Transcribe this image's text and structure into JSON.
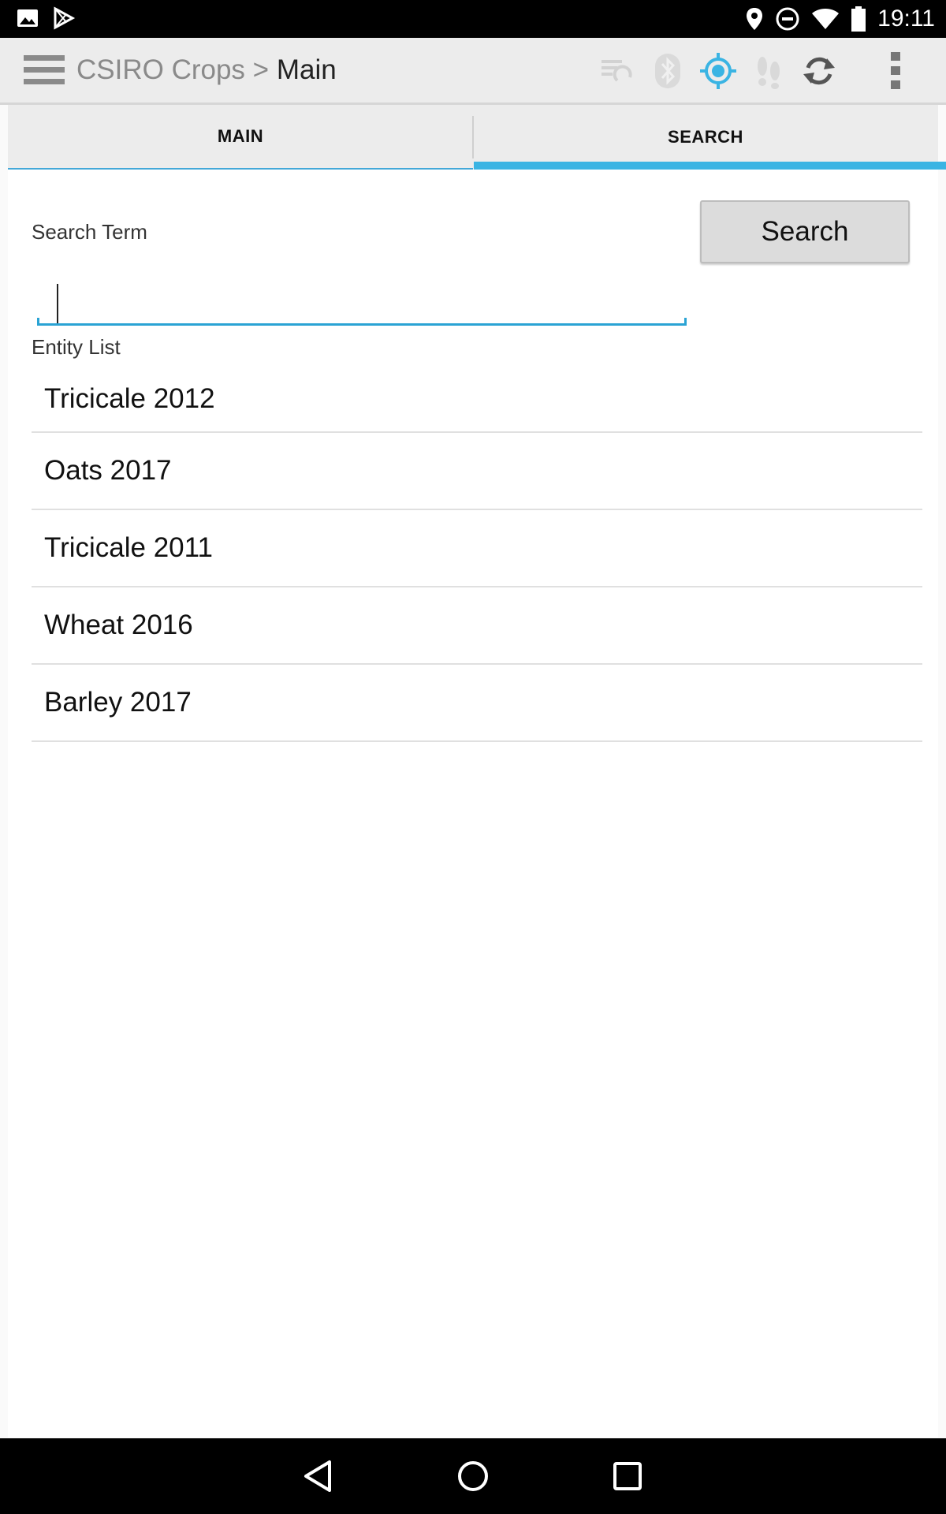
{
  "status_bar": {
    "time": "19:11",
    "left_icons": [
      "image-icon",
      "play-store-icon"
    ],
    "right_icons": [
      "location-pin-icon",
      "do-not-disturb-icon",
      "wifi-icon",
      "battery-icon"
    ]
  },
  "action_bar": {
    "breadcrumb_parent": "CSIRO Crops",
    "breadcrumb_separator": ">",
    "breadcrumb_current": "Main",
    "icons": [
      "sync-list-icon",
      "bluetooth-icon",
      "gps-target-icon",
      "footsteps-icon",
      "refresh-icon",
      "overflow-menu-icon"
    ],
    "accent_color": "#3ab4e3"
  },
  "tabs": [
    {
      "label": "MAIN",
      "selected": false
    },
    {
      "label": "SEARCH",
      "selected": true
    }
  ],
  "search": {
    "label": "Search Term",
    "input_value": "",
    "button_label": "Search"
  },
  "entity_list": {
    "label": "Entity List",
    "items": [
      "Tricicale 2012",
      "Oats 2017",
      "Tricicale 2011",
      "Wheat 2016",
      "Barley 2017"
    ]
  },
  "nav_bar": {
    "buttons": [
      "back-icon",
      "home-icon",
      "recents-icon"
    ]
  }
}
